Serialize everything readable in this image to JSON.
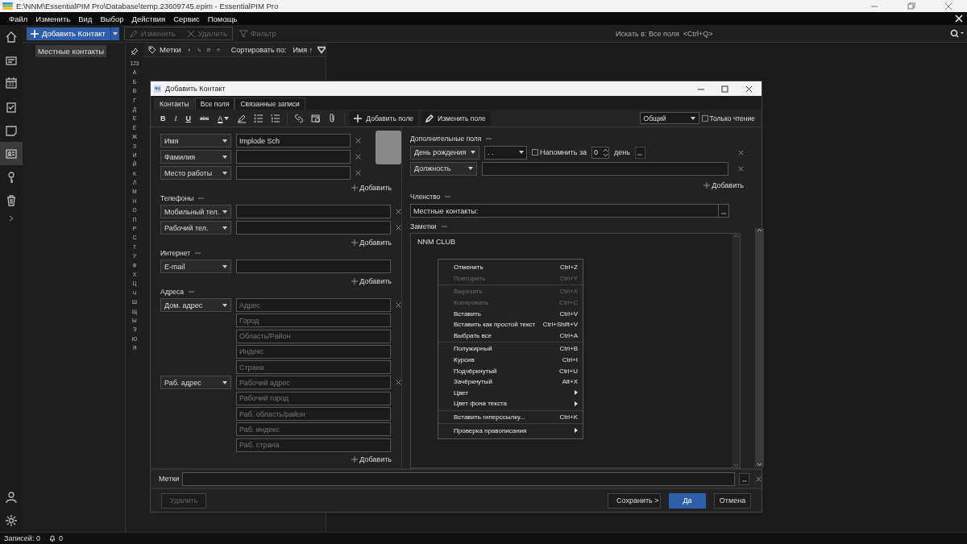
{
  "window": {
    "title": "E:\\NNM\\EssentialPIM Pro\\Database\\temp.23609745.epim - EssentialPIM Pro"
  },
  "menu": [
    "Файл",
    "Изменить",
    "Вид",
    "Выбор",
    "Действия",
    "Сервис",
    "Помощь"
  ],
  "rail": {
    "items": [
      {
        "kind": "home",
        "selected": false
      },
      {
        "kind": "cards",
        "selected": false
      },
      {
        "kind": "calendar",
        "label": "31",
        "selected": false
      },
      {
        "kind": "tasks",
        "selected": false
      },
      {
        "kind": "notes",
        "selected": false
      },
      {
        "kind": "contacts",
        "selected": true
      },
      {
        "kind": "passwords",
        "selected": false
      },
      {
        "kind": "trash",
        "selected": false
      }
    ],
    "bottom": [
      {
        "kind": "account",
        "selected": false
      },
      {
        "kind": "settings",
        "selected": false
      }
    ]
  },
  "toolbar": {
    "add": "Добавить Контакт",
    "edit": {
      "label": "Изменить",
      "disabled": true
    },
    "delete": {
      "label": "Удалить",
      "disabled": true
    },
    "filter": {
      "label": "Фильтр",
      "disabled": true
    },
    "search": {
      "placeholder": "Искать в: Все поля  <Ctrl+Q>"
    }
  },
  "sidebar": {
    "items": [
      {
        "label": "Местные контакты",
        "selected": true
      }
    ]
  },
  "alphabet": [
    "123",
    "А",
    "Б",
    "В",
    "Г",
    "Д",
    "Е",
    "Ё",
    "Ж",
    "З",
    "И",
    "Й",
    "К",
    "Л",
    "М",
    "Н",
    "О",
    "П",
    "Р",
    "С",
    "Т",
    "У",
    "Ф",
    "Х",
    "Ц",
    "Ч",
    "Ш",
    "Щ",
    "Ы",
    "Э",
    "Ю",
    "Я"
  ],
  "list_toolbar": {
    "tags": "Метки",
    "sort_label": "Сортировать по:",
    "sort_value": "Имя ↑"
  },
  "dialog": {
    "title": "Добавить Контакт",
    "tabs": [
      {
        "label": "Контакты",
        "selected": true
      },
      {
        "label": "Все поля",
        "selected": false
      },
      {
        "label": "Связанные записи",
        "selected": false
      }
    ],
    "format_buttons": [
      {
        "kind": "bold",
        "label": "B"
      },
      {
        "kind": "italic",
        "label": "I"
      },
      {
        "kind": "underline",
        "label": "U"
      },
      {
        "kind": "strike",
        "label": "abc"
      },
      {
        "kind": "color",
        "label": "A"
      }
    ],
    "add_field": "Добавить поле",
    "edit_field": "Изменить поле",
    "access": "Общий",
    "read_only": {
      "label": "Только чтение",
      "checked": false
    },
    "names": {
      "fields": [
        {
          "type": "Имя",
          "value": "Implode Sch"
        },
        {
          "type": "Фамилия"
        },
        {
          "type": "Место работы"
        }
      ],
      "add": "Добавить"
    },
    "phones": {
      "title": "Телефоны",
      "fields": [
        {
          "type": "Мобильный тел."
        },
        {
          "type": "Рабочий тел."
        }
      ],
      "add": "Добавить"
    },
    "internet": {
      "title": "Интернет",
      "fields": [
        {
          "type": "E-mail"
        }
      ],
      "add": "Добавить"
    },
    "addresses": {
      "title": "Адреса",
      "groups": [
        {
          "type": "Дом. адрес",
          "placeholders": [
            "Адрес",
            "Город",
            "Область/Район",
            "Индекс",
            "Страна"
          ]
        },
        {
          "type": "Раб. адрес",
          "placeholders": [
            "Рабочий адрес",
            "Рабочий город",
            "Раб. область/район",
            "Раб. индекс",
            "Раб. страна"
          ]
        }
      ],
      "add": "Добавить"
    },
    "extra": {
      "title": "Дополнительные поля",
      "birthday": {
        "type": "День рождения",
        "date": ". .",
        "remind": {
          "label": "Напомнить за",
          "checked": false
        },
        "days": "0",
        "unit": "день"
      },
      "fields": [
        {
          "type": "Должность"
        }
      ],
      "add": "Добавить"
    },
    "membership": {
      "title": "Членство",
      "value": "Местные контакты:"
    },
    "notes": {
      "title": "Заметки",
      "text": "NNM CLUB"
    },
    "tags_label": "Метки",
    "buttons": {
      "delete": {
        "label": "Удалить",
        "disabled": true
      },
      "save": "Сохранить >",
      "ok": "Да",
      "cancel": "Отмена"
    }
  },
  "context_menu": [
    [
      {
        "label": "Отменить",
        "shortcut": "Ctrl+Z",
        "disabled": false
      },
      {
        "label": "Повторить",
        "shortcut": "Ctrl+Y",
        "disabled": true
      }
    ],
    [
      {
        "label": "Вырезать",
        "shortcut": "Ctrl+X",
        "disabled": true
      },
      {
        "label": "Копировать",
        "shortcut": "Ctrl+C",
        "disabled": true
      },
      {
        "label": "Вставить",
        "shortcut": "Ctrl+V",
        "disabled": false
      },
      {
        "label": "Вставить как простой текст",
        "shortcut": "Ctrl+Shift+V",
        "disabled": false
      },
      {
        "label": "Выбрать все",
        "shortcut": "Ctrl+A",
        "disabled": false
      }
    ],
    [
      {
        "label": "Полужирный",
        "shortcut": "Ctrl+B",
        "disabled": false
      },
      {
        "label": "Курсив",
        "shortcut": "Ctrl+I",
        "disabled": false
      },
      {
        "label": "Подчёркнутый",
        "shortcut": "Ctrl+U",
        "disabled": false
      },
      {
        "label": "Зачёркнутый",
        "shortcut": "Alt+X",
        "disabled": false
      },
      {
        "label": "Цвет",
        "submenu": true,
        "disabled": false
      },
      {
        "label": "Цвет фона текста",
        "submenu": true,
        "disabled": false
      }
    ],
    [
      {
        "label": "Вставить гиперссылку...",
        "shortcut": "Ctrl+K",
        "disabled": false
      }
    ],
    [
      {
        "label": "Проверка правописания",
        "submenu": true,
        "disabled": false
      }
    ]
  ],
  "status_bar": {
    "records": "Записей: 0",
    "notifications": "0"
  }
}
